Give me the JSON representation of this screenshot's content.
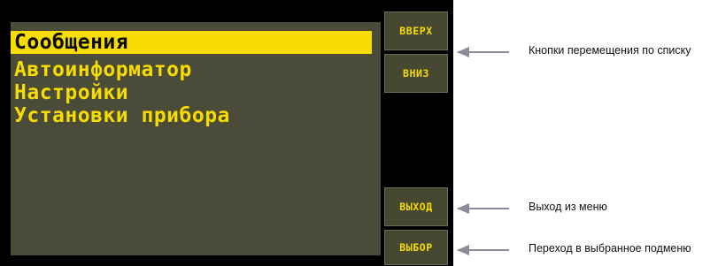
{
  "menu": {
    "items": [
      {
        "label": "Сообщения",
        "selected": true
      },
      {
        "label": "Автоинформатор",
        "selected": false
      },
      {
        "label": "Настройки",
        "selected": false
      },
      {
        "label": "Установки прибора",
        "selected": false
      }
    ]
  },
  "buttons": {
    "up": "ВВЕРХ",
    "down": "ВНИЗ",
    "exit": "ВЫХОД",
    "select": "ВЫБОР"
  },
  "callouts": {
    "navigation": "Кнопки перемещения по списку",
    "exit": "Выход из меню",
    "select": "Переход в выбранное подменю"
  },
  "colors": {
    "screen_background": "#4a4b38",
    "text_accent": "#f6dc00",
    "device_frame": "#000000",
    "arrow": "#8b8b99"
  }
}
